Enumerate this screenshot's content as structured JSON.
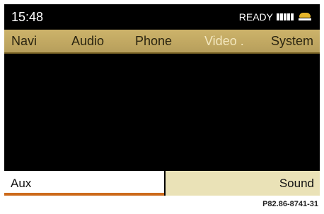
{
  "status": {
    "time": "15:48",
    "text": "READY",
    "icons": [
      "signal-strength-icon",
      "phone-icon"
    ]
  },
  "menu": {
    "items": [
      {
        "label": "Navi",
        "active": false
      },
      {
        "label": "Audio",
        "active": false
      },
      {
        "label": "Phone",
        "active": false
      },
      {
        "label": "Video .",
        "active": true
      },
      {
        "label": "System",
        "active": false
      }
    ]
  },
  "bottom": {
    "left_label": "Aux",
    "right_label": "Sound"
  },
  "reference": "P82.86-8741-31",
  "colors": {
    "screen_background": "#000000",
    "menu_bar": "#c4aa64",
    "active_menu_text": "#f3e7bf",
    "selected_underline": "#cc6a1a",
    "sound_button": "#eae2b7"
  }
}
